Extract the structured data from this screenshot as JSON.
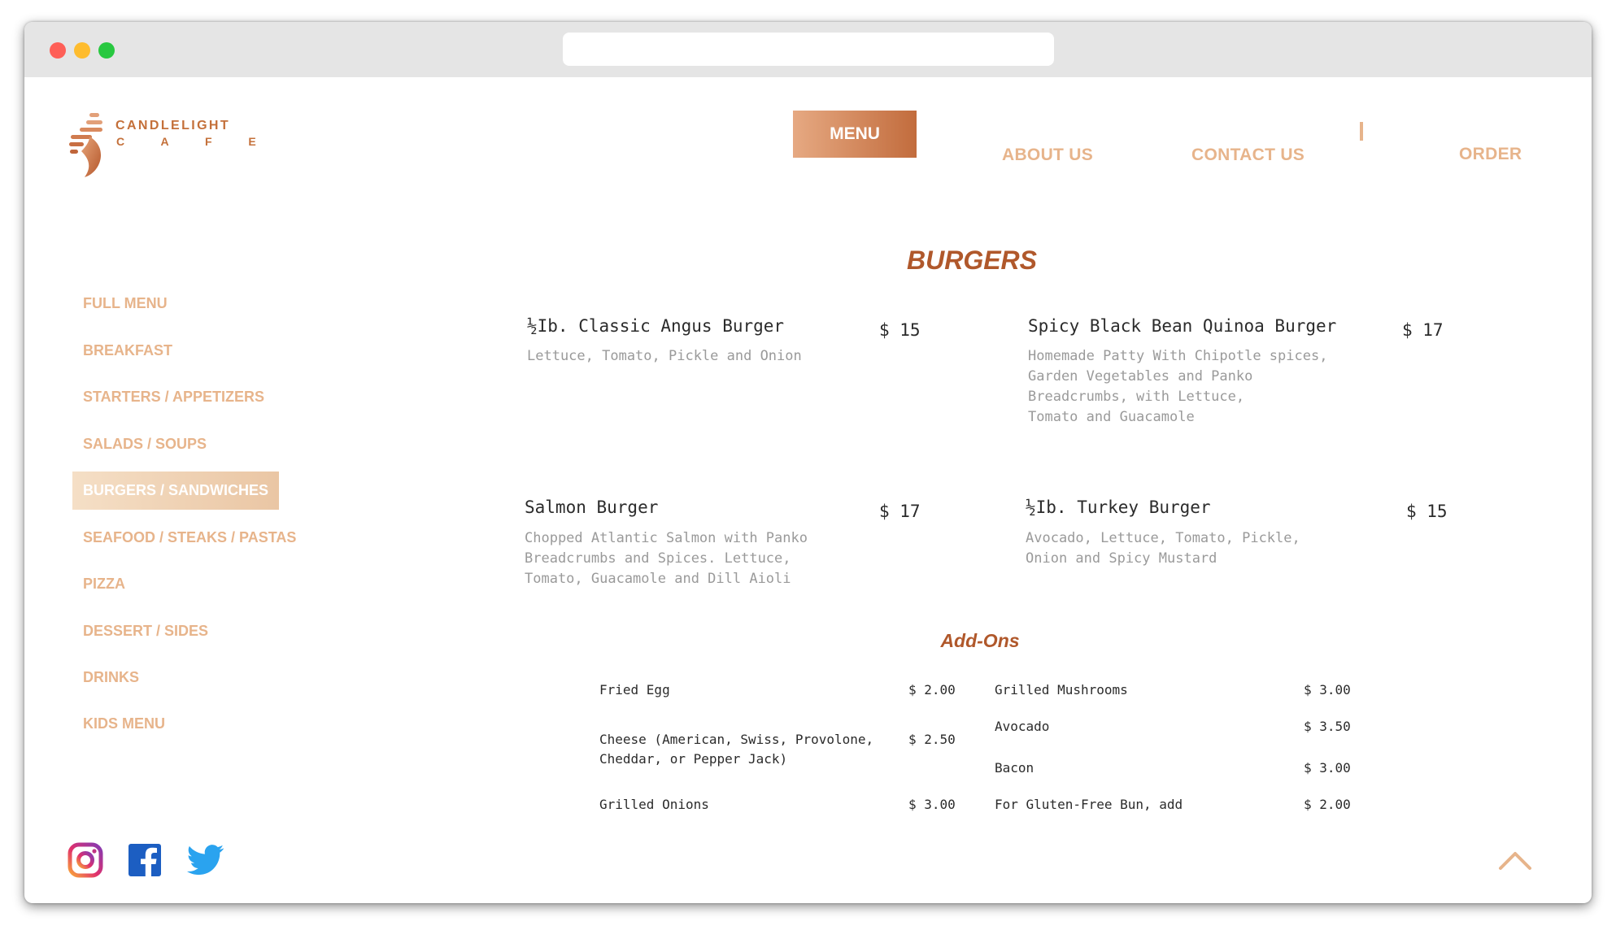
{
  "brand": {
    "name": "CANDLELIGHT",
    "sub": "C A F E"
  },
  "nav": {
    "menu": "MENU",
    "about": "ABOUT US",
    "contact": "CONTACT US",
    "order": "ORDER"
  },
  "sidebar": {
    "items": [
      {
        "label": "FULL MENU",
        "active": false
      },
      {
        "label": "BREAKFAST",
        "active": false
      },
      {
        "label": "STARTERS / APPETIZERS",
        "active": false
      },
      {
        "label": "SALADS / SOUPS",
        "active": false
      },
      {
        "label": "BURGERS / SANDWICHES",
        "active": true
      },
      {
        "label": "SEAFOOD / STEAKS / PASTAS",
        "active": false
      },
      {
        "label": "PIZZA",
        "active": false
      },
      {
        "label": "DESSERT / SIDES",
        "active": false
      },
      {
        "label": "DRINKS",
        "active": false
      },
      {
        "label": "KIDS MENU",
        "active": false
      }
    ]
  },
  "section": {
    "title": "BURGERS"
  },
  "items": [
    {
      "name": "½Ib. Classic Angus Burger",
      "price": "$ 15",
      "desc": "Lettuce, Tomato, Pickle and Onion"
    },
    {
      "name": "Spicy Black Bean Quinoa Burger",
      "price": "$ 17",
      "desc": "Homemade Patty With Chipotle spices,\nGarden Vegetables and Panko\nBreadcrumbs, with Lettuce,\nTomato and Guacamole"
    },
    {
      "name": "Salmon Burger",
      "price": "$ 17",
      "desc": "Chopped Atlantic Salmon with Panko\nBreadcrumbs and Spices. Lettuce,\nTomato, Guacamole and Dill Aioli"
    },
    {
      "name": "½Ib. Turkey Burger",
      "price": "$ 15",
      "desc": "Avocado, Lettuce, Tomato, Pickle,\nOnion and Spicy Mustard"
    }
  ],
  "addons": {
    "title": "Add-Ons",
    "left": [
      {
        "name": "Fried Egg",
        "price": "$ 2.00"
      },
      {
        "name": "Cheese (American, Swiss, Provolone,\nCheddar, or Pepper Jack)",
        "price": "$ 2.50"
      },
      {
        "name": "Grilled Onions",
        "price": "$ 3.00"
      }
    ],
    "right": [
      {
        "name": "Grilled Mushrooms",
        "price": "$ 3.00"
      },
      {
        "name": "Avocado",
        "price": "$ 3.50"
      },
      {
        "name": "Bacon",
        "price": "$ 3.00"
      },
      {
        "name": "For Gluten-Free Bun, add",
        "price": "$ 2.00"
      }
    ]
  },
  "social": {
    "icons": [
      "instagram-icon",
      "facebook-icon",
      "twitter-icon"
    ]
  },
  "colors": {
    "accent": "#c4703a",
    "nav_text": "#e7b48b",
    "section_title": "#b0582b"
  }
}
